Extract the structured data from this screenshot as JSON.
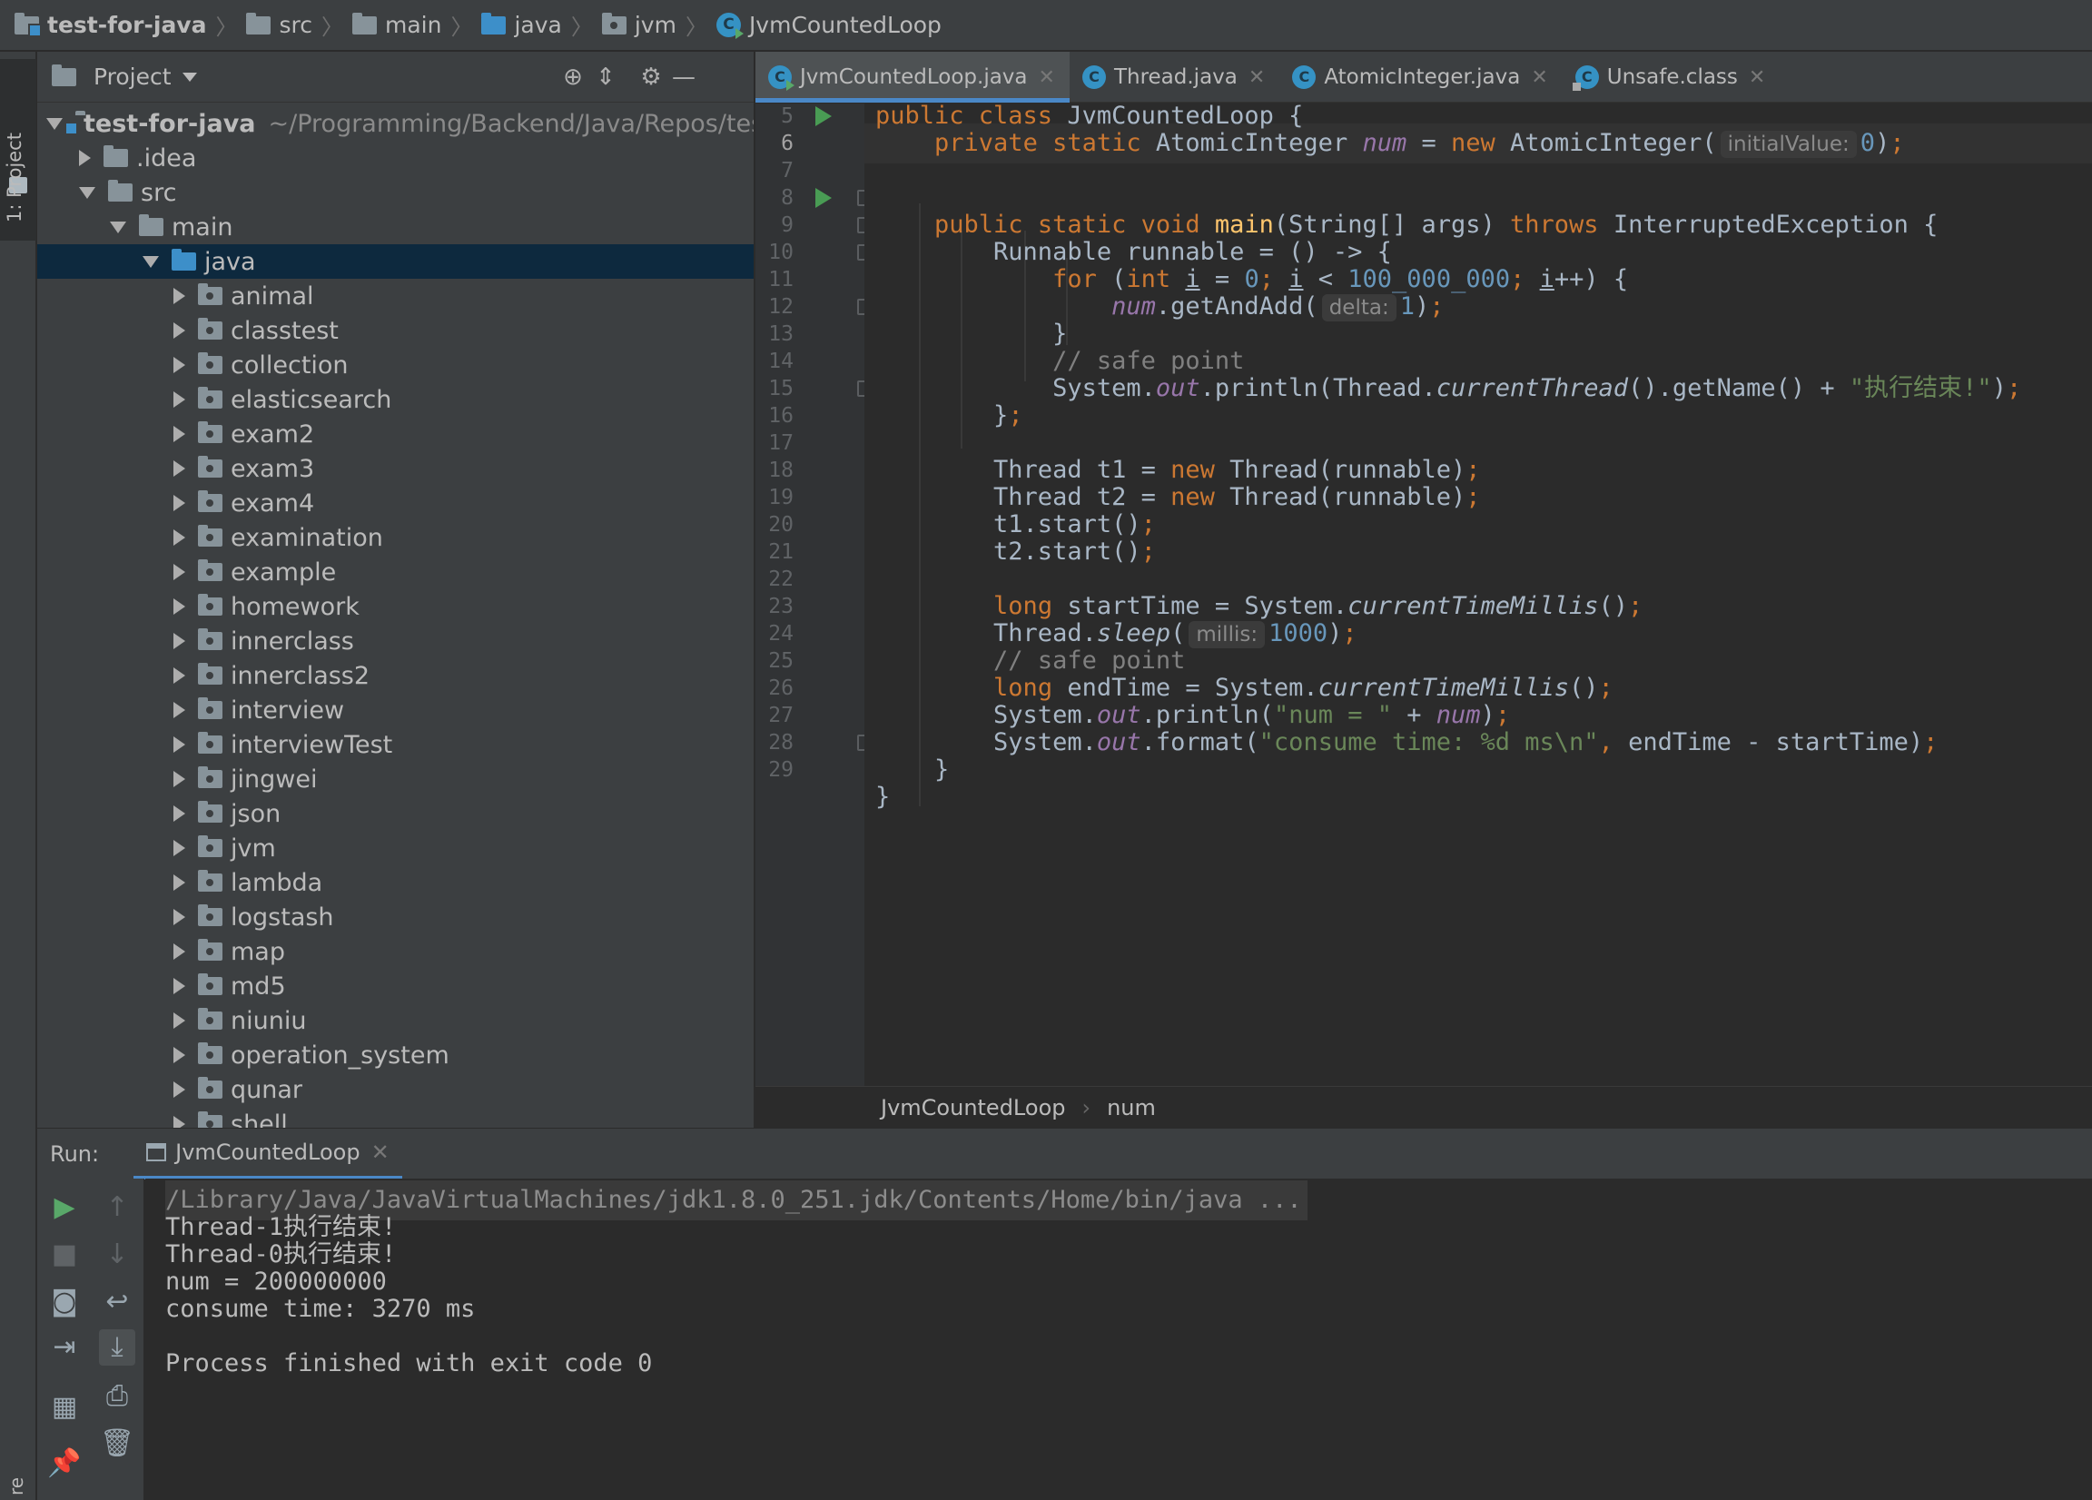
{
  "breadcrumb": {
    "items": [
      "test-for-java",
      "src",
      "main",
      "java",
      "jvm",
      "JvmCountedLoop"
    ]
  },
  "left_strip": {
    "project_tab": "1: Project",
    "bottom_tab": "re"
  },
  "project": {
    "title": "Project",
    "root_name": "test-for-java",
    "root_path": "~/Programming/Backend/Java/Repos/tes",
    "idea": ".idea",
    "src": "src",
    "main": "main",
    "java": "java",
    "packages": [
      "animal",
      "classtest",
      "collection",
      "elasticsearch",
      "exam2",
      "exam3",
      "exam4",
      "examination",
      "example",
      "homework",
      "innerclass",
      "innerclass2",
      "interview",
      "interviewTest",
      "jingwei",
      "json",
      "jvm",
      "lambda",
      "logstash",
      "map",
      "md5",
      "niuniu",
      "operation_system",
      "qunar",
      "shell"
    ]
  },
  "editor": {
    "tabs": [
      "JvmCountedLoop.java",
      "Thread.java",
      "AtomicInteger.java",
      "Unsafe.class"
    ],
    "active_tab": "JvmCountedLoop.java",
    "line_numbers": [
      "5",
      "6",
      "7",
      "8",
      "9",
      "10",
      "11",
      "12",
      "13",
      "14",
      "15",
      "16",
      "17",
      "18",
      "19",
      "20",
      "21",
      "22",
      "23",
      "24",
      "25",
      "26",
      "27",
      "28",
      "29"
    ],
    "current_line": "6",
    "hints": {
      "initial_value": "initialValue:",
      "delta": "delta:",
      "millis": "millis:"
    },
    "code": {
      "class_decl": "JvmCountedLoop",
      "chinese_msg": "\"执行结束!\""
    },
    "structure_crumb": [
      "JvmCountedLoop",
      "num"
    ]
  },
  "run": {
    "label": "Run:",
    "tab": "JvmCountedLoop",
    "output": [
      "/Library/Java/JavaVirtualMachines/jdk1.8.0_251.jdk/Contents/Home/bin/java ...",
      "Thread-1执行结束!",
      "Thread-0执行结束!",
      "num = 200000000",
      "consume time: 3270 ms",
      "",
      "Process finished with exit code 0"
    ]
  },
  "colors": {
    "keyword": "#cc7832",
    "field": "#9876aa",
    "number": "#6897bb",
    "string": "#6a8759",
    "comment": "#808080",
    "method_decl": "#ffc66d",
    "selection": "#0d293e",
    "accent": "#4a88c7"
  }
}
